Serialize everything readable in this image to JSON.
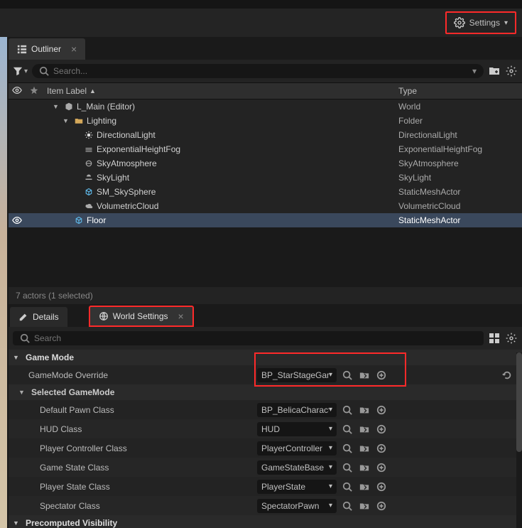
{
  "topbar": {
    "settings_label": "Settings"
  },
  "outliner": {
    "tab_label": "Outliner",
    "search_placeholder": "Search...",
    "header": {
      "item_label": "Item Label",
      "type": "Type"
    },
    "rows": [
      {
        "label": "L_Main (Editor)",
        "type": "World",
        "indent": 0,
        "expander": "▼",
        "icon": "world",
        "selected": false
      },
      {
        "label": "Lighting",
        "type": "Folder",
        "indent": 1,
        "expander": "▼",
        "icon": "folder",
        "selected": false
      },
      {
        "label": "DirectionalLight",
        "type": "DirectionalLight",
        "indent": 2,
        "expander": "",
        "icon": "sun",
        "selected": false
      },
      {
        "label": "ExponentialHeightFog",
        "type": "ExponentialHeightFog",
        "indent": 2,
        "expander": "",
        "icon": "fog",
        "selected": false
      },
      {
        "label": "SkyAtmosphere",
        "type": "SkyAtmosphere",
        "indent": 2,
        "expander": "",
        "icon": "atmo",
        "selected": false
      },
      {
        "label": "SkyLight",
        "type": "SkyLight",
        "indent": 2,
        "expander": "",
        "icon": "skylight",
        "selected": false
      },
      {
        "label": "SM_SkySphere",
        "type": "StaticMeshActor",
        "indent": 2,
        "expander": "",
        "icon": "mesh",
        "selected": false
      },
      {
        "label": "VolumetricCloud",
        "type": "VolumetricCloud",
        "indent": 2,
        "expander": "",
        "icon": "cloud",
        "selected": false
      },
      {
        "label": "Floor",
        "type": "StaticMeshActor",
        "indent": 1,
        "expander": "",
        "icon": "mesh",
        "selected": true
      }
    ],
    "status": "7 actors (1 selected)"
  },
  "details": {
    "tab_details": "Details",
    "tab_world": "World Settings",
    "search_placeholder": "Search",
    "categories": {
      "game_mode": "Game Mode",
      "selected_game_mode": "Selected GameMode",
      "precomputed": "Precomputed Visibility"
    },
    "props": {
      "gamemode_override": {
        "label": "GameMode Override",
        "value": "BP_StarStageGam"
      },
      "default_pawn": {
        "label": "Default Pawn Class",
        "value": "BP_BelicaCharact"
      },
      "hud": {
        "label": "HUD Class",
        "value": "HUD"
      },
      "player_controller": {
        "label": "Player Controller Class",
        "value": "PlayerController"
      },
      "game_state": {
        "label": "Game State Class",
        "value": "GameStateBase"
      },
      "player_state": {
        "label": "Player State Class",
        "value": "PlayerState"
      },
      "spectator": {
        "label": "Spectator Class",
        "value": "SpectatorPawn"
      }
    }
  }
}
